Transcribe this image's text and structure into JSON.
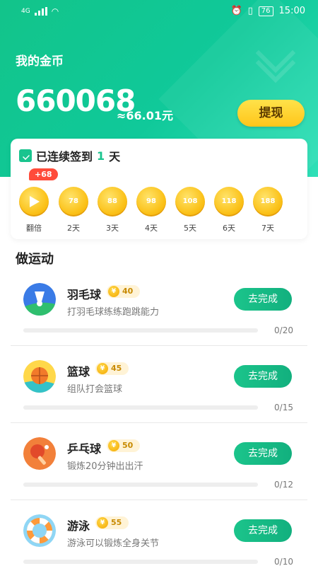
{
  "status_bar": {
    "network": "4G",
    "battery": "76",
    "time": "15:00"
  },
  "wallet": {
    "title": "我的金币",
    "coins": "660068",
    "approx": "≈66.01元",
    "withdraw_label": "提现"
  },
  "checkin": {
    "prefix": "已连续签到",
    "days": "1",
    "suffix": "天",
    "bonus_tag": "+68",
    "items": [
      {
        "coin": "",
        "label": "翻倍"
      },
      {
        "coin": "78",
        "label": "2天"
      },
      {
        "coin": "88",
        "label": "3天"
      },
      {
        "coin": "98",
        "label": "4天"
      },
      {
        "coin": "108",
        "label": "5天"
      },
      {
        "coin": "118",
        "label": "6天"
      },
      {
        "coin": "188",
        "label": "7天"
      }
    ]
  },
  "section_title": "做运动",
  "tasks": [
    {
      "name": "羽毛球",
      "reward": "40",
      "desc": "打羽毛球练练跑跳能力",
      "button": "去完成",
      "count": "0/20",
      "progress": 0
    },
    {
      "name": "篮球",
      "reward": "45",
      "desc": "组队打会篮球",
      "button": "去完成",
      "count": "0/15",
      "progress": 0
    },
    {
      "name": "乒乓球",
      "reward": "50",
      "desc": "锻炼20分钟出出汗",
      "button": "去完成",
      "count": "0/12",
      "progress": 0
    },
    {
      "name": "游泳",
      "reward": "55",
      "desc": "游泳可以锻炼全身关节",
      "button": "去完成",
      "count": "0/10",
      "progress": 0
    }
  ],
  "colors": {
    "primary": "#19c48e",
    "gold": "#fbc21a",
    "bonus": "#ff4b3a"
  },
  "icons": [
    "badminton-icon",
    "basketball-icon",
    "ping-pong-icon",
    "swim-ring-icon"
  ]
}
